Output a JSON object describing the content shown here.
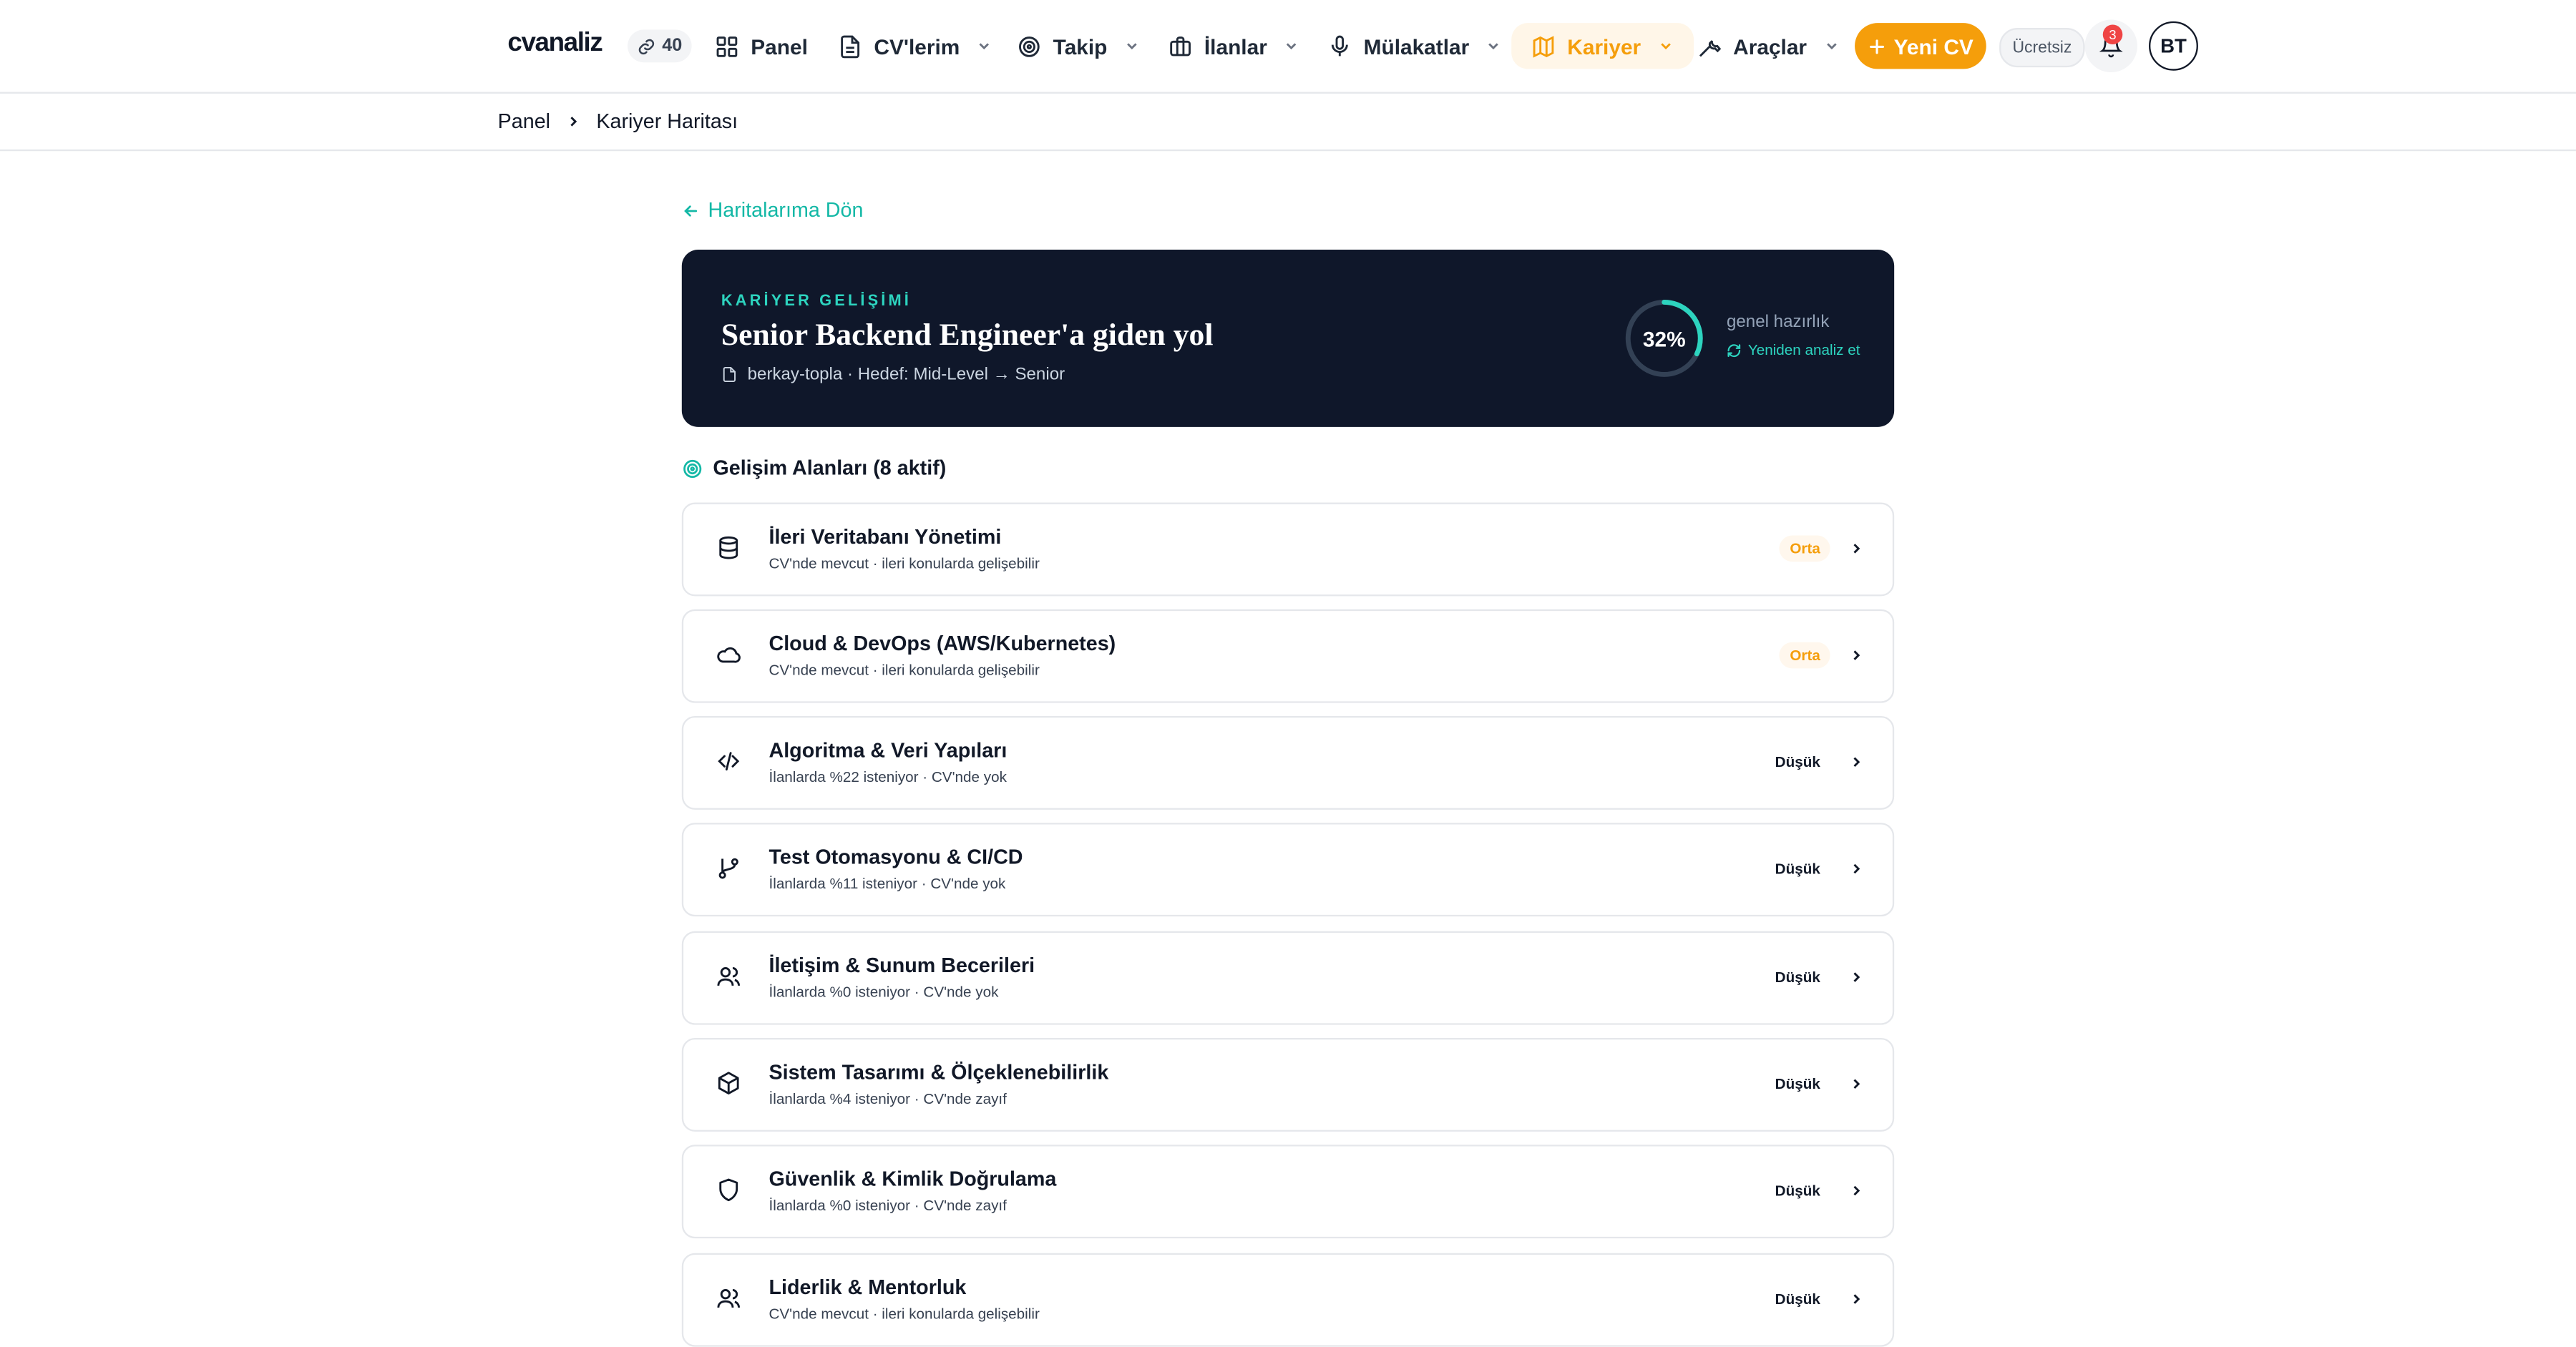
{
  "brand": {
    "logo": "cvanaliz",
    "credits": "40",
    "accent": "#f59e0b",
    "teal": "#14b8a6"
  },
  "nav": {
    "items": [
      {
        "label": "Panel",
        "icon": "grid-icon"
      },
      {
        "label": "CV'lerim",
        "icon": "file-icon"
      },
      {
        "label": "Takip",
        "icon": "target-icon"
      },
      {
        "label": "İlanlar",
        "icon": "briefcase-icon"
      },
      {
        "label": "Mülakatlar",
        "icon": "mic-icon"
      },
      {
        "label": "Kariyer",
        "icon": "map-icon"
      },
      {
        "label": "Araçlar",
        "icon": "wrench-icon"
      }
    ],
    "new_cv": "Yeni CV",
    "plan_badge": "Ücretsiz",
    "notification_count": "3",
    "avatar_initials": "BT"
  },
  "breadcrumb": {
    "root": "Panel",
    "current": "Kariyer Haritası"
  },
  "back_link": "Haritalarıma Dön",
  "hero": {
    "kicker": "KARİYER GELİŞİMİ",
    "title": "Senior Backend Engineer'a giden yol",
    "meta": "berkay-topla · Hedef: Mid-Level → Senior",
    "readiness_percent": 32,
    "readiness_text": "32%",
    "readiness_label": "genel hazırlık",
    "reanalyze": "Yeniden analiz et"
  },
  "areas": {
    "heading": "Gelişim Alanları (8 aktif)",
    "items": [
      {
        "title": "İleri Veritabanı Yönetimi",
        "subtitle": "CV'nde mevcut · ileri konularda gelişebilir",
        "level": "Orta",
        "icon": "database-icon"
      },
      {
        "title": "Cloud & DevOps (AWS/Kubernetes)",
        "subtitle": "CV'nde mevcut · ileri konularda gelişebilir",
        "level": "Orta",
        "icon": "cloud-icon"
      },
      {
        "title": "Algoritma & Veri Yapıları",
        "subtitle": "İlanlarda %22 isteniyor · CV'nde yok",
        "level": "Düşük",
        "icon": "code-icon"
      },
      {
        "title": "Test Otomasyonu & CI/CD",
        "subtitle": "İlanlarda %11 isteniyor · CV'nde yok",
        "level": "Düşük",
        "icon": "git-branch-icon"
      },
      {
        "title": "İletişim & Sunum Becerileri",
        "subtitle": "İlanlarda %0 isteniyor · CV'nde yok",
        "level": "Düşük",
        "icon": "users-icon"
      },
      {
        "title": "Sistem Tasarımı & Ölçeklenebilirlik",
        "subtitle": "İlanlarda %4 isteniyor · CV'nde zayıf",
        "level": "Düşük",
        "icon": "box-icon"
      },
      {
        "title": "Güvenlik & Kimlik Doğrulama",
        "subtitle": "İlanlarda %0 isteniyor · CV'nde zayıf",
        "level": "Düşük",
        "icon": "shield-icon"
      },
      {
        "title": "Liderlik & Mentorluk",
        "subtitle": "CV'nde mevcut · ileri konularda gelişebilir",
        "level": "Düşük",
        "icon": "users-icon"
      }
    ]
  }
}
